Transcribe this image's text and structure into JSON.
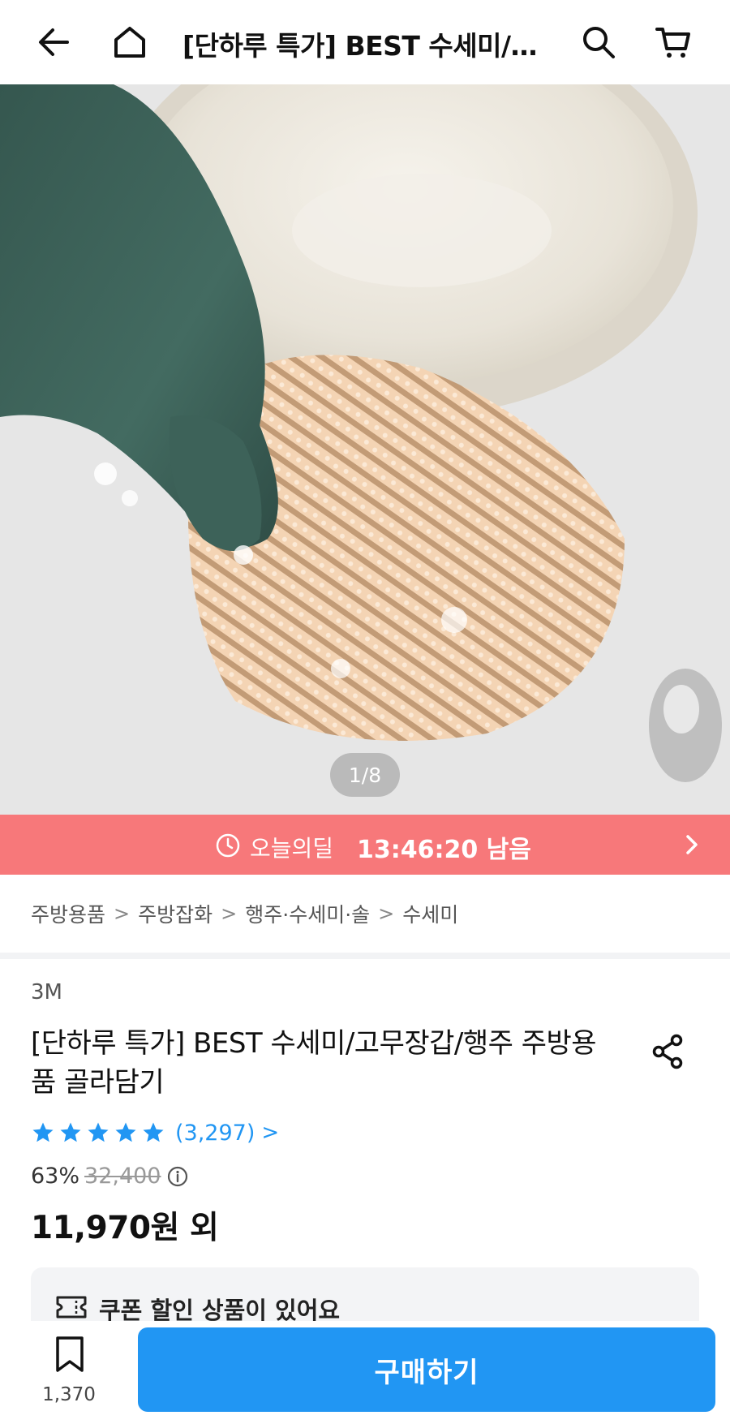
{
  "header": {
    "title": "[단하루 특가] BEST 수세미/고무장갑/행주 주방용품 골라담기"
  },
  "gallery": {
    "counter": "1/8"
  },
  "deal": {
    "label": "오늘의딜",
    "countdown": "13:46:20 남음"
  },
  "breadcrumb": {
    "items": [
      "주방용품",
      "주방잡화",
      "행주·수세미·솔",
      "수세미"
    ]
  },
  "product": {
    "brand": "3M",
    "title": "[단하루 특가] BEST 수세미/고무장갑/행주 주방용품 골라담기",
    "rating": 5,
    "review_count": "(3,297)",
    "discount": "63%",
    "original_price": "32,400",
    "price": "11,970원 외"
  },
  "coupon": {
    "text": "쿠폰 할인 상품이 있어요"
  },
  "bottom": {
    "wish_count": "1,370",
    "buy_label": "구매하기"
  },
  "colors": {
    "accent": "#2196f3",
    "deal_bar": "#f7787a",
    "star": "#2196f3"
  }
}
